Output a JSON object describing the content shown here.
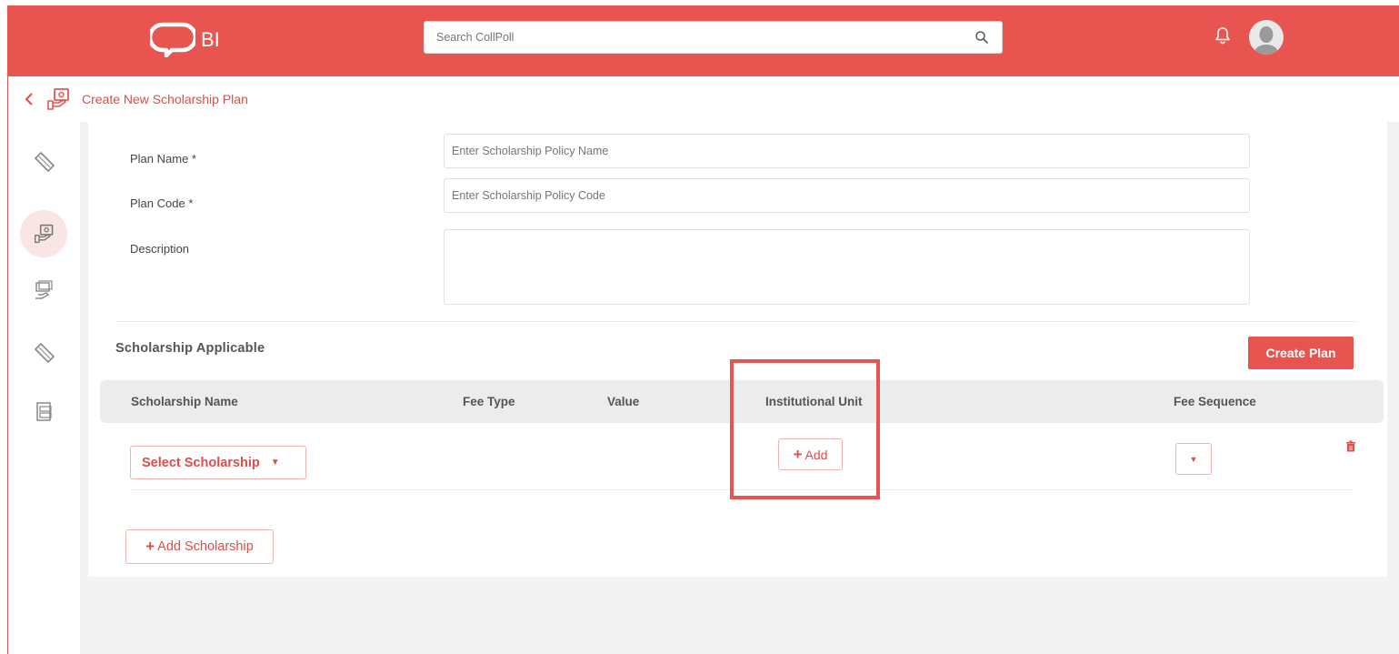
{
  "header": {
    "logo_text": "BI",
    "search_placeholder": "Search CollPoll"
  },
  "breadcrumb": {
    "title": "Create New Scholarship Plan"
  },
  "form": {
    "plan_name_label": "Plan Name *",
    "plan_name_placeholder": "Enter Scholarship Policy Name",
    "plan_code_label": "Plan Code *",
    "plan_code_placeholder": "Enter Scholarship Policy Code",
    "description_label": "Description"
  },
  "scholarship_section": {
    "title": "Scholarship Applicable",
    "create_plan_label": "Create Plan",
    "columns": [
      "Scholarship Name",
      "Fee Type",
      "Value",
      "Institutional Unit",
      "Fee Sequence"
    ],
    "row": {
      "select_label": "Select Scholarship",
      "add_label": "Add"
    },
    "add_scholarship_label": "Add Scholarship"
  },
  "colors": {
    "brand": "#e8544f",
    "brand_text": "#e04c47"
  }
}
